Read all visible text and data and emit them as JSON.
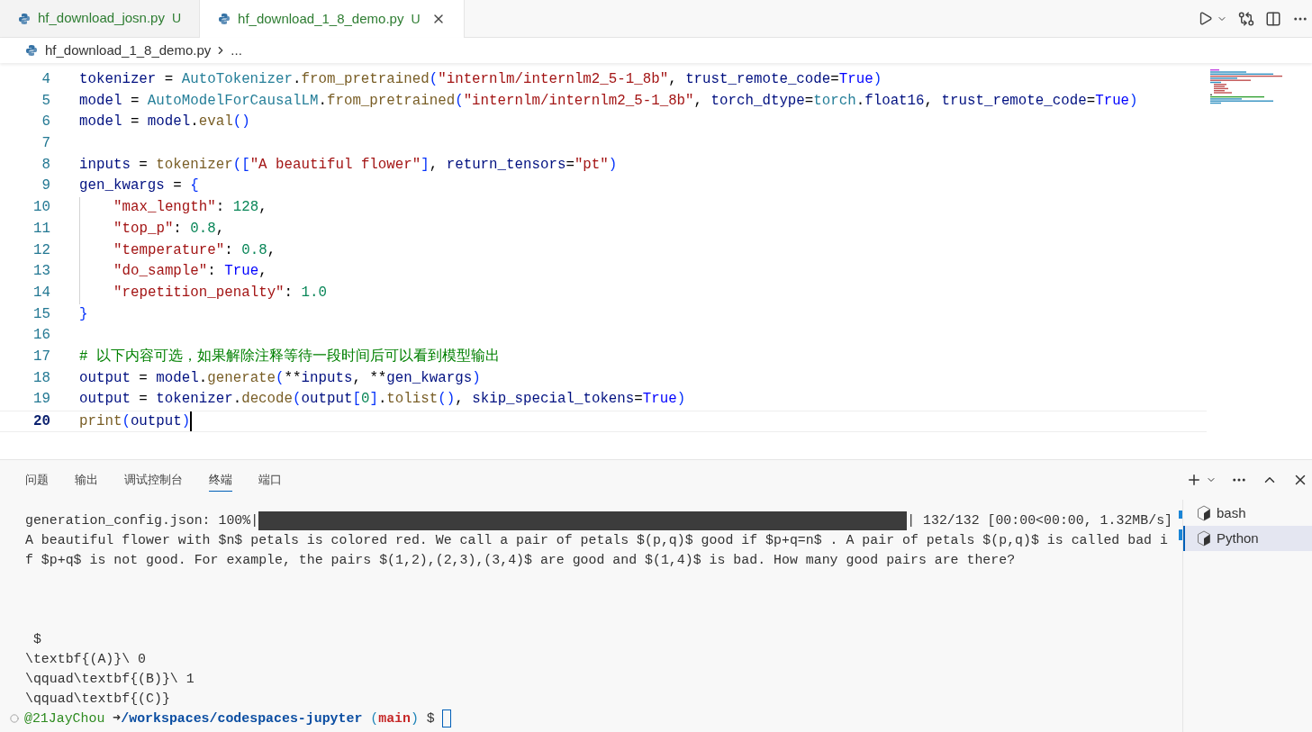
{
  "tabs": [
    {
      "label": "hf_download_josn.py",
      "badge": "U",
      "selected": false,
      "closable": false
    },
    {
      "label": "hf_download_1_8_demo.py",
      "badge": "U",
      "selected": true,
      "closable": true
    }
  ],
  "breadcrumb": {
    "file": "hf_download_1_8_demo.py",
    "rest": "..."
  },
  "editor": {
    "lines": [
      {
        "number": "4",
        "current": false,
        "tokens": [
          {
            "kind": "var",
            "text": "tokenizer"
          },
          {
            "kind": "plain",
            "text": " = "
          },
          {
            "kind": "class",
            "text": "AutoTokenizer"
          },
          {
            "kind": "plain",
            "text": "."
          },
          {
            "kind": "func",
            "text": "from_pretrained"
          },
          {
            "kind": "bracket",
            "text": "("
          },
          {
            "kind": "string",
            "text": "\"internlm/internlm2_5-1_8b\""
          },
          {
            "kind": "plain",
            "text": ", "
          },
          {
            "kind": "var",
            "text": "trust_remote_code"
          },
          {
            "kind": "plain",
            "text": "="
          },
          {
            "kind": "keyword",
            "text": "True"
          },
          {
            "kind": "bracket",
            "text": ")"
          }
        ]
      },
      {
        "number": "5",
        "current": false,
        "tokens": [
          {
            "kind": "var",
            "text": "model"
          },
          {
            "kind": "plain",
            "text": " = "
          },
          {
            "kind": "class",
            "text": "AutoModelForCausalLM"
          },
          {
            "kind": "plain",
            "text": "."
          },
          {
            "kind": "func",
            "text": "from_pretrained"
          },
          {
            "kind": "bracket",
            "text": "("
          },
          {
            "kind": "string",
            "text": "\"internlm/internlm2_5-1_8b\""
          },
          {
            "kind": "plain",
            "text": ", "
          },
          {
            "kind": "var",
            "text": "torch_dtype"
          },
          {
            "kind": "plain",
            "text": "="
          },
          {
            "kind": "class",
            "text": "torch"
          },
          {
            "kind": "plain",
            "text": "."
          },
          {
            "kind": "var",
            "text": "float16"
          },
          {
            "kind": "plain",
            "text": ", "
          },
          {
            "kind": "var",
            "text": "trust_remote_code"
          },
          {
            "kind": "plain",
            "text": "="
          },
          {
            "kind": "keyword",
            "text": "True"
          },
          {
            "kind": "bracket",
            "text": ")"
          }
        ]
      },
      {
        "number": "6",
        "current": false,
        "tokens": [
          {
            "kind": "var",
            "text": "model"
          },
          {
            "kind": "plain",
            "text": " = "
          },
          {
            "kind": "var",
            "text": "model"
          },
          {
            "kind": "plain",
            "text": "."
          },
          {
            "kind": "func",
            "text": "eval"
          },
          {
            "kind": "bracket",
            "text": "()"
          }
        ]
      },
      {
        "number": "7",
        "current": false
      },
      {
        "number": "8",
        "current": false,
        "tokens": [
          {
            "kind": "var",
            "text": "inputs"
          },
          {
            "kind": "plain",
            "text": " = "
          },
          {
            "kind": "func",
            "text": "tokenizer"
          },
          {
            "kind": "bracket",
            "text": "(["
          },
          {
            "kind": "string",
            "text": "\"A beautiful flower\""
          },
          {
            "kind": "bracket",
            "text": "]"
          },
          {
            "kind": "plain",
            "text": ", "
          },
          {
            "kind": "var",
            "text": "return_tensors"
          },
          {
            "kind": "plain",
            "text": "="
          },
          {
            "kind": "string",
            "text": "\"pt\""
          },
          {
            "kind": "bracket",
            "text": ")"
          }
        ]
      },
      {
        "number": "9",
        "current": false,
        "tokens": [
          {
            "kind": "var",
            "text": "gen_kwargs"
          },
          {
            "kind": "plain",
            "text": " = "
          },
          {
            "kind": "bracket",
            "text": "{"
          }
        ]
      },
      {
        "number": "10",
        "current": false,
        "indented": true,
        "tokens": [
          {
            "kind": "string",
            "text": "\"max_length\""
          },
          {
            "kind": "plain",
            "text": ": "
          },
          {
            "kind": "number",
            "text": "128"
          },
          {
            "kind": "plain",
            "text": ","
          }
        ]
      },
      {
        "number": "11",
        "current": false,
        "indented": true,
        "tokens": [
          {
            "kind": "string",
            "text": "\"top_p\""
          },
          {
            "kind": "plain",
            "text": ": "
          },
          {
            "kind": "number",
            "text": "0.8"
          },
          {
            "kind": "plain",
            "text": ","
          }
        ]
      },
      {
        "number": "12",
        "current": false,
        "indented": true,
        "tokens": [
          {
            "kind": "string",
            "text": "\"temperature\""
          },
          {
            "kind": "plain",
            "text": ": "
          },
          {
            "kind": "number",
            "text": "0.8"
          },
          {
            "kind": "plain",
            "text": ","
          }
        ]
      },
      {
        "number": "13",
        "current": false,
        "indented": true,
        "tokens": [
          {
            "kind": "string",
            "text": "\"do_sample\""
          },
          {
            "kind": "plain",
            "text": ": "
          },
          {
            "kind": "keyword",
            "text": "True"
          },
          {
            "kind": "plain",
            "text": ","
          }
        ]
      },
      {
        "number": "14",
        "current": false,
        "indented": true,
        "tokens": [
          {
            "kind": "string",
            "text": "\"repetition_penalty\""
          },
          {
            "kind": "plain",
            "text": ": "
          },
          {
            "kind": "number",
            "text": "1.0"
          }
        ]
      },
      {
        "number": "15",
        "current": false,
        "tokens": [
          {
            "kind": "bracket",
            "text": "}"
          }
        ]
      },
      {
        "number": "16",
        "current": false
      },
      {
        "number": "17",
        "current": false,
        "tokens": [
          {
            "kind": "comment",
            "text": "# 以下内容可选，如果解除注释等待一段时间后可以看到模型输出"
          }
        ]
      },
      {
        "number": "18",
        "current": false,
        "tokens": [
          {
            "kind": "var",
            "text": "output"
          },
          {
            "kind": "plain",
            "text": " = "
          },
          {
            "kind": "var",
            "text": "model"
          },
          {
            "kind": "plain",
            "text": "."
          },
          {
            "kind": "func",
            "text": "generate"
          },
          {
            "kind": "bracket",
            "text": "("
          },
          {
            "kind": "plain",
            "text": "**"
          },
          {
            "kind": "var",
            "text": "inputs"
          },
          {
            "kind": "plain",
            "text": ", **"
          },
          {
            "kind": "var",
            "text": "gen_kwargs"
          },
          {
            "kind": "bracket",
            "text": ")"
          }
        ]
      },
      {
        "number": "19",
        "current": false,
        "tokens": [
          {
            "kind": "var",
            "text": "output"
          },
          {
            "kind": "plain",
            "text": " = "
          },
          {
            "kind": "var",
            "text": "tokenizer"
          },
          {
            "kind": "plain",
            "text": "."
          },
          {
            "kind": "func",
            "text": "decode"
          },
          {
            "kind": "bracket",
            "text": "("
          },
          {
            "kind": "var",
            "text": "output"
          },
          {
            "kind": "bracket",
            "text": "["
          },
          {
            "kind": "number",
            "text": "0"
          },
          {
            "kind": "bracket",
            "text": "]"
          },
          {
            "kind": "plain",
            "text": "."
          },
          {
            "kind": "func",
            "text": "tolist"
          },
          {
            "kind": "bracket",
            "text": "()"
          },
          {
            "kind": "plain",
            "text": ", "
          },
          {
            "kind": "var",
            "text": "skip_special_tokens"
          },
          {
            "kind": "plain",
            "text": "="
          },
          {
            "kind": "keyword",
            "text": "True"
          },
          {
            "kind": "bracket",
            "text": ")"
          }
        ]
      },
      {
        "number": "20",
        "current": true,
        "tokens": [
          {
            "kind": "func",
            "text": "print"
          },
          {
            "kind": "bracket",
            "text": "("
          },
          {
            "kind": "var",
            "text": "output"
          },
          {
            "kind": "bracket",
            "text": ")"
          }
        ]
      }
    ]
  },
  "panel": {
    "tabs": [
      {
        "label": "问题",
        "selected": false
      },
      {
        "label": "输出",
        "selected": false
      },
      {
        "label": "调试控制台",
        "selected": false
      },
      {
        "label": "终端",
        "selected": true
      },
      {
        "label": "端口",
        "selected": false
      }
    ],
    "terminal": {
      "progress": {
        "label": "generation_config.json: 100%|",
        "level": 1,
        "stats": "| 132/132 [00:00<00:00, 1.32MB/s]"
      },
      "lines": [
        "A beautiful flower with $n$ petals is colored red. We call a pair of petals $(p,q)$ good if $p+q=n$ . A pair of petals $(p,q)$ is called bad i",
        "f $p+q$ is not good. For example, the pairs $(1,2),(2,3),(3,4)$ are good and $(1,4)$ is bad. How many good pairs are there?"
      ],
      "lines_after_gap": [
        " $",
        "\\textbf{(A)}\\ 0",
        "\\qquad\\textbf{(B)}\\ 1",
        "\\qquad\\textbf{(C)}"
      ],
      "prompt": {
        "user": "@21JayChou",
        "arrow": "➜",
        "path": "/workspaces/codespaces-jupyter",
        "branch_open": "(",
        "branch": "main",
        "branch_close": ")",
        "symbol": "$"
      }
    },
    "sessions": [
      {
        "label": "bash",
        "selected": false
      },
      {
        "label": "Python",
        "selected": true
      }
    ]
  }
}
